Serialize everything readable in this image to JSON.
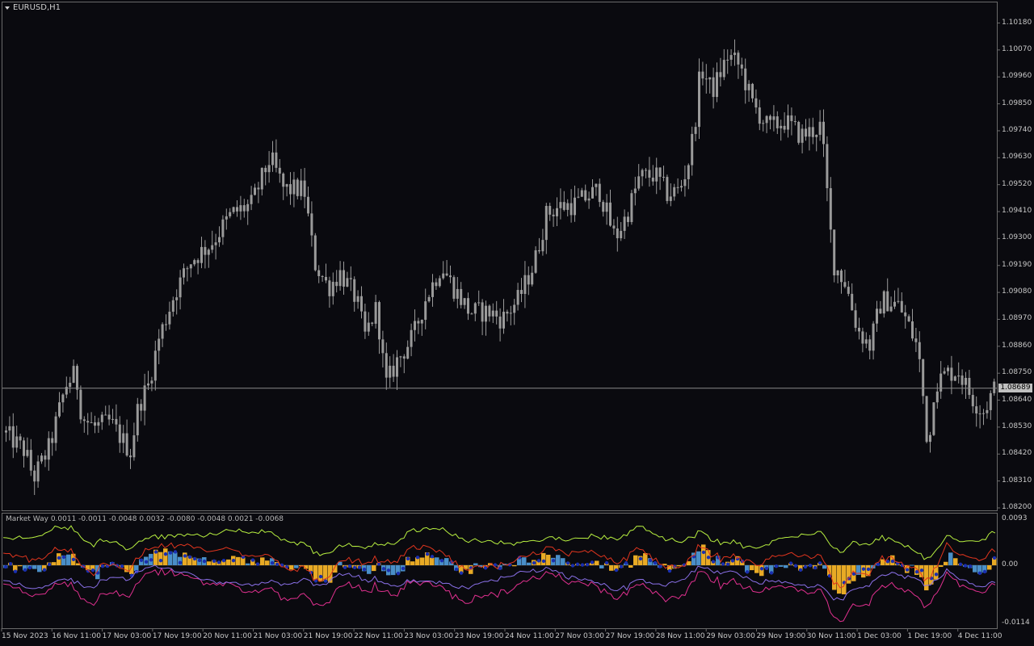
{
  "window": {
    "symbol_label": "EURUSD,H1",
    "menu_icon": "triangle-down-icon"
  },
  "price_axis": {
    "labels": [
      "1.10180",
      "1.10070",
      "1.09960",
      "1.09850",
      "1.09740",
      "1.09630",
      "1.09520",
      "1.09410",
      "1.09300",
      "1.09190",
      "1.09080",
      "1.08970",
      "1.08860",
      "1.08750",
      "1.08640",
      "1.08530",
      "1.08420",
      "1.08310",
      "1.08200"
    ],
    "current_price": "1.08689"
  },
  "time_axis": {
    "labels": [
      "15 Nov 2023",
      "16 Nov 11:00",
      "17 Nov 03:00",
      "17 Nov 19:00",
      "20 Nov 11:00",
      "21 Nov 03:00",
      "21 Nov 19:00",
      "22 Nov 11:00",
      "23 Nov 03:00",
      "23 Nov 19:00",
      "24 Nov 11:00",
      "27 Nov 03:00",
      "27 Nov 19:00",
      "28 Nov 11:00",
      "29 Nov 03:00",
      "29 Nov 19:00",
      "30 Nov 11:00",
      "1 Dec 03:00",
      "1 Dec 19:00",
      "4 Dec 11:00"
    ]
  },
  "indicator": {
    "label": "Market Way 0.0011 -0.0011 -0.0048 0.0032 -0.0080 -0.0048 0.0021 -0.0068",
    "axis_labels": [
      "0.0093",
      "0.00",
      "-0.0114"
    ]
  },
  "colors": {
    "background": "#0a0a0f",
    "candle": "#9a9a9a",
    "grid_line": "#8a8a8a",
    "hist_gold": "#e8aa25",
    "hist_blue": "#4a8fc8",
    "dot_navy": "#1a2fb0",
    "line_green": "#b8f040",
    "line_red": "#e0351e",
    "line_magenta": "#e0308f",
    "line_violet": "#8a70e8"
  },
  "chart_data": {
    "type": "candlestick",
    "symbol": "EURUSD",
    "timeframe": "H1",
    "ylim": [
      1.082,
      1.1018
    ],
    "last_price": 1.08689,
    "close_path": [
      [
        0,
        1.0852
      ],
      [
        30,
        1.0843
      ],
      [
        40,
        1.0832
      ],
      [
        60,
        1.0845
      ],
      [
        80,
        1.087
      ],
      [
        92,
        1.0875
      ],
      [
        100,
        1.0857
      ],
      [
        115,
        1.0853
      ],
      [
        135,
        1.0855
      ],
      [
        160,
        1.0843
      ],
      [
        170,
        1.0862
      ],
      [
        182,
        1.087
      ],
      [
        195,
        1.0889
      ],
      [
        215,
        1.0908
      ],
      [
        235,
        1.0921
      ],
      [
        260,
        1.0928
      ],
      [
        285,
        1.094
      ],
      [
        310,
        1.0944
      ],
      [
        333,
        1.0963
      ],
      [
        350,
        1.095
      ],
      [
        375,
        1.095
      ],
      [
        388,
        1.092
      ],
      [
        405,
        1.091
      ],
      [
        420,
        1.0916
      ],
      [
        440,
        1.0905
      ],
      [
        450,
        1.089
      ],
      [
        465,
        1.0902
      ],
      [
        476,
        1.087
      ],
      [
        490,
        1.088
      ],
      [
        510,
        1.089
      ],
      [
        525,
        1.0905
      ],
      [
        545,
        1.0919
      ],
      [
        560,
        1.091
      ],
      [
        580,
        1.09
      ],
      [
        605,
        1.09
      ],
      [
        620,
        1.0897
      ],
      [
        640,
        1.0905
      ],
      [
        660,
        1.092
      ],
      [
        675,
        1.094
      ],
      [
        690,
        1.0943
      ],
      [
        710,
        1.0944
      ],
      [
        740,
        1.095
      ],
      [
        760,
        1.093
      ],
      [
        775,
        1.094
      ],
      [
        790,
        1.0955
      ],
      [
        810,
        1.0956
      ],
      [
        825,
        1.0948
      ],
      [
        840,
        1.095
      ],
      [
        850,
        1.096
      ],
      [
        858,
        1.0975
      ],
      [
        866,
        1.1
      ],
      [
        880,
        1.099
      ],
      [
        900,
        1.1005
      ],
      [
        915,
        1.1
      ],
      [
        930,
        1.0985
      ],
      [
        950,
        1.0975
      ],
      [
        970,
        1.0978
      ],
      [
        990,
        1.0972
      ],
      [
        1005,
        1.0974
      ],
      [
        1015,
        1.0976
      ],
      [
        1022,
        1.095
      ],
      [
        1030,
        1.092
      ],
      [
        1045,
        1.0912
      ],
      [
        1060,
        1.0893
      ],
      [
        1075,
        1.0886
      ],
      [
        1090,
        1.0905
      ],
      [
        1110,
        1.0903
      ],
      [
        1120,
        1.0897
      ],
      [
        1135,
        1.0885
      ],
      [
        1142,
        1.0863
      ],
      [
        1148,
        1.0842
      ],
      [
        1155,
        1.087
      ],
      [
        1170,
        1.0875
      ],
      [
        1185,
        1.0876
      ],
      [
        1200,
        1.0866
      ],
      [
        1215,
        1.0859
      ],
      [
        1230,
        1.08689
      ]
    ],
    "indicator": {
      "name": "Market Way",
      "values": [
        0.0011,
        -0.0011,
        -0.0048,
        0.0032,
        -0.008,
        -0.0048,
        0.0021,
        -0.0068
      ],
      "ylim": [
        -0.0114,
        0.0093
      ]
    }
  }
}
